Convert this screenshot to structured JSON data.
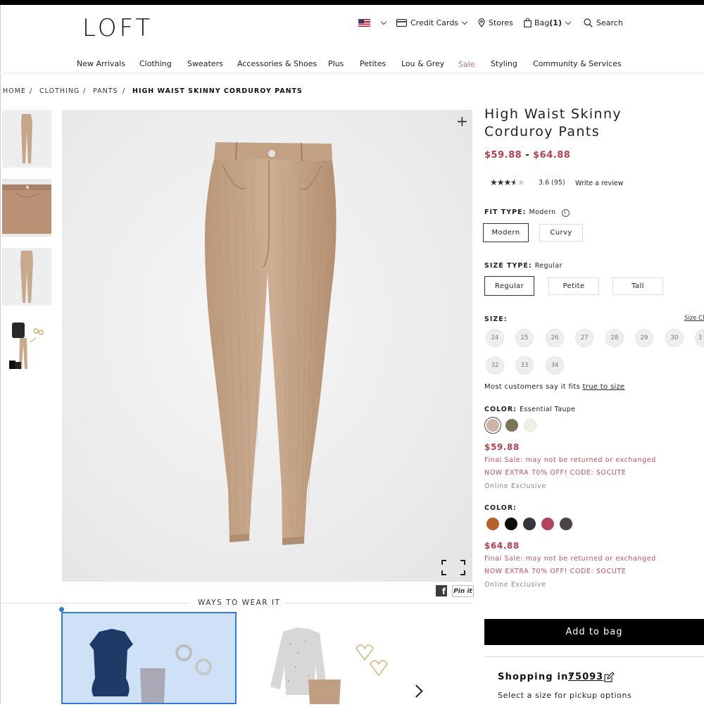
{
  "header": {
    "logo": "LOFT",
    "utility": {
      "credit_cards": "Credit Cards",
      "stores": "Stores",
      "bag": "Bag",
      "bag_count": "(1)",
      "search": "Search"
    }
  },
  "nav": [
    "New Arrivals",
    "Clothing",
    "Sweaters",
    "Accessories & Shoes",
    "Plus",
    "Petites",
    "Lou & Grey",
    "Sale",
    "Styling",
    "Community & Services"
  ],
  "breadcrumb": [
    "HOME",
    "/",
    "CLOTHING",
    "/",
    "PANTS",
    "/",
    "HIGH WAIST SKINNY CORDUROY PANTS"
  ],
  "product": {
    "title": "High Waist Skinny Corduroy Pants",
    "price_low": "$59.88",
    "price_sep": "-",
    "price_high": "$64.88",
    "stars": "★★★★★",
    "rating": "3.6 (95)",
    "rating_value": 3.6,
    "write_review": "Write a review",
    "fit_type_label": "FIT TYPE:",
    "fit_type_value": "Modern",
    "fit_options": [
      "Modern",
      "Curvy"
    ],
    "size_type_label": "SIZE TYPE:",
    "size_type_value": "Regular",
    "size_type_options": [
      "Regular",
      "Petite",
      "Tall"
    ],
    "size_label": "SIZE:",
    "size_chart": "Size Ch",
    "sizes": [
      "24",
      "25",
      "26",
      "27",
      "28",
      "29",
      "30",
      "3",
      "32",
      "33",
      "34"
    ],
    "fit_note": "Most customers say it fits",
    "fit_note_link": "true to size",
    "color_group_1": {
      "label": "COLOR:",
      "value": "Essential Taupe",
      "swatches": [
        "#cdb2aa",
        "#7a7556",
        "#eef0e4"
      ],
      "price": "$59.88",
      "final_sale": "Final Sale: may not be returned or exchanged",
      "promo": "NOW EXTRA 70% OFF! CODE: SOCUTE",
      "exclusive": "Online Exclusive"
    },
    "color_group_2": {
      "label": "COLOR:",
      "swatches": [
        "#b5622a",
        "#0d0d0d",
        "#33363a",
        "#b24660",
        "#4b4448"
      ],
      "price": "$64.88",
      "final_sale": "Final Sale: may not be returned or exchanged",
      "promo": "NOW EXTRA 70% OFF! CODE: SOCUTE",
      "exclusive": "Online Exclusive"
    },
    "add_to_bag": "Add to bag",
    "shopping_in_label": "Shopping in:",
    "zip": "75093",
    "pickup_note": "Select a size for pickup options"
  },
  "gallery": {
    "share_facebook": "f",
    "share_pin": "Pin it",
    "ways_to_wear": "WAYS TO WEAR IT"
  },
  "colors": {
    "accent_price": "#b3414e",
    "sale_nav": "#c06a8c",
    "outfit_highlight": "#2e7cd6"
  }
}
